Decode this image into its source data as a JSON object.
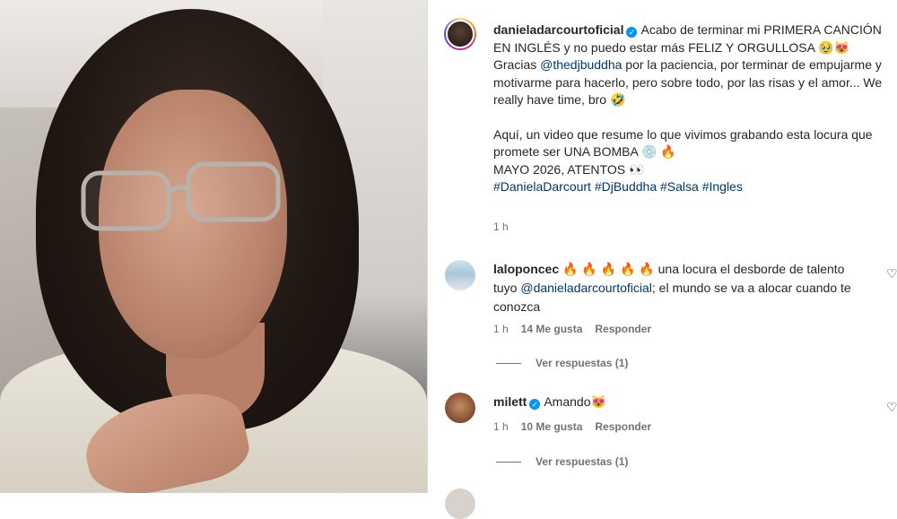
{
  "post": {
    "username": "danieladarcourtoficial",
    "caption_line1": "Acabo de terminar mi PRIMERA CANCIÓN EN INGLÉS y no puedo estar más FELIZ Y ORGULLOSA 🥹😻",
    "thanks_pre": "Gracias ",
    "thanks_mention": "@thedjbuddha",
    "thanks_post": " por la paciencia, por terminar de empujarme y motivarme para hacerlo, pero sobre todo, por las risas y el amor... We really have time, bro 🤣",
    "video_text": "Aquí, un video que resume lo que vivimos grabando esta locura que promete ser UNA BOMBA 💿 🔥",
    "date_text": "MAYO 2026, ATENTOS 👀",
    "hashtags": "#DanielaDarcourt #DjBuddha #Salsa #Ingles",
    "time": "1 h"
  },
  "comments": [
    {
      "username": "laloponcec",
      "text_pre": "🔥 🔥 🔥 🔥 🔥 una locura el desborde de talento tuyo ",
      "mention": "@danieladarcourtoficial",
      "text_post": "; el mundo se va a alocar cuando te conozca",
      "time": "1 h",
      "likes": "14 Me gusta",
      "reply": "Responder",
      "view_replies": "Ver respuestas (1)"
    },
    {
      "username": "milett",
      "text": "Amando😻",
      "time": "1 h",
      "likes": "10 Me gusta",
      "reply": "Responder",
      "view_replies": "Ver respuestas (1)"
    }
  ],
  "icons": {
    "verified": "verified-badge-icon",
    "heart": "heart-outline-icon"
  },
  "colors": {
    "link": "#00376b",
    "verified": "#0095f6",
    "muted": "#737373"
  }
}
